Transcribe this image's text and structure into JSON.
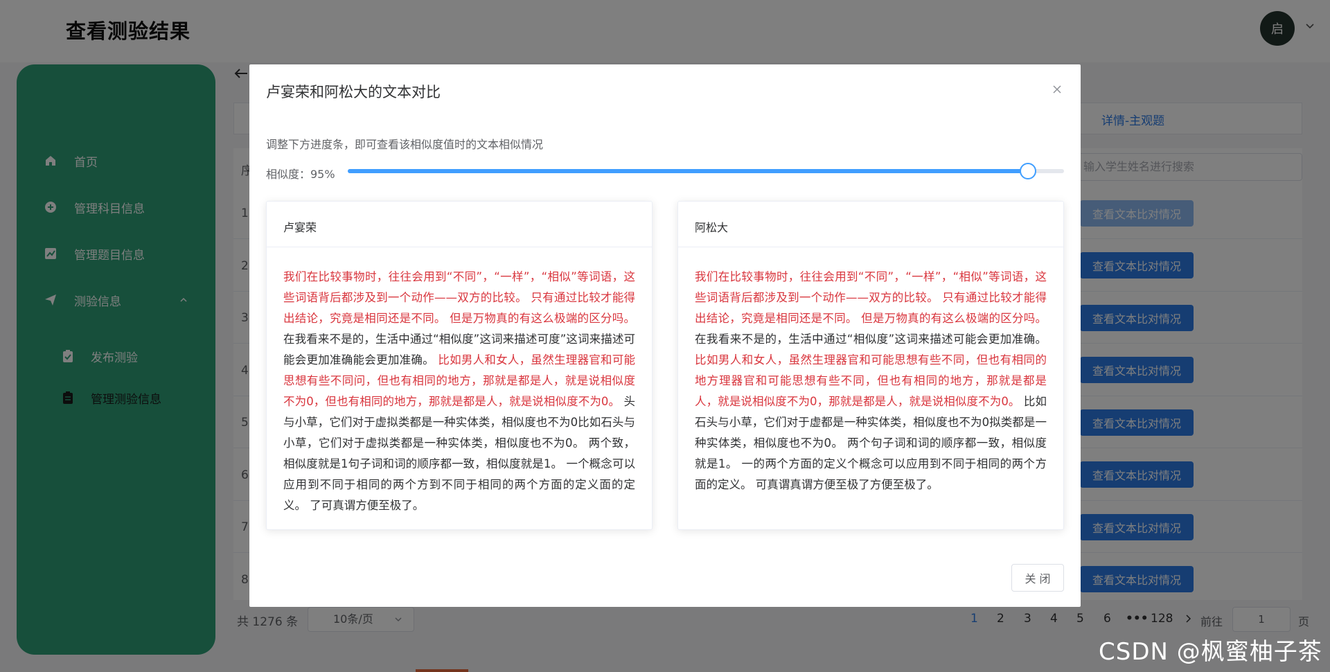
{
  "header": {
    "title": "查看测验结果",
    "avatar_text": "启"
  },
  "sidebar": {
    "items": [
      {
        "label": "首页",
        "icon": "home-icon"
      },
      {
        "label": "管理科目信息",
        "icon": "plus-circle-icon"
      },
      {
        "label": "管理题目信息",
        "icon": "chart-icon"
      },
      {
        "label": "测验信息",
        "icon": "send-icon"
      },
      {
        "label": "发布测验",
        "icon": "clipboard-check-icon"
      },
      {
        "label": "管理测验信息",
        "icon": "clipboard-icon"
      }
    ]
  },
  "main": {
    "tab_detail": "详情-主观题",
    "search_placeholder": "输入学生姓名进行搜索",
    "row_numbers": [
      "序",
      "1",
      "2",
      "3",
      "4",
      "5",
      "6",
      "7",
      "8"
    ],
    "view_button_label": "查看文本比对情况",
    "pagination": {
      "total": "共 1276 条",
      "page_size": "10条/页",
      "pages": [
        "1",
        "2",
        "3",
        "4",
        "5",
        "6",
        "•••",
        "128"
      ],
      "goto_label": "前往",
      "goto_value": "1",
      "page_unit": "页"
    }
  },
  "dialog": {
    "title": "卢宴荣和阿松大的文本对比",
    "hint": "调整下方进度条，即可查看该相似度值时的文本相似情况",
    "similarity_label": "相似度：95%",
    "similarity_value": 0.95,
    "close_button": "关 闭",
    "left_card": {
      "name": "卢宴荣",
      "segments": [
        {
          "text": "我们在比较事物时，往往会用到“不同”，“一样”，“相似”等词语，这些词语背后都涉及到一个动作——双方的比较。 只有通过比较才能得出结论，究竟是相同还是不同。 但是万物真的有这么极端的区分吗。",
          "red": true
        },
        {
          "text": " 在我看来不是的，生活中通过“相似度”这词来描述可度”这词来描述可能会更加准确能会更加准确。",
          "red": false
        },
        {
          "text": " 比如男人和女人，虽然生理器官和可能思想有些不同问，但也有相同的地方，那就是都是人，就是说相似度不为0，但也有相同的地方，那就是都是人，就是说相似度不为0。",
          "red": true
        },
        {
          "text": " 头与小草，它们对于虚拟类都是一种实体类，相似度也不为0比如石头与小草，它们对于虚拟类都是一种实体类，相似度也不为0。 两个致，相似度就是1句子词和词的顺序都一致，相似度就是1。 一个概念可以应用到不同于相同的两个方到不同于相同的两个方面的定义面的定义。 了可真谓方便至极了。",
          "red": false
        }
      ]
    },
    "right_card": {
      "name": "阿松大",
      "segments": [
        {
          "text": "我们在比较事物时，往往会用到“不同”，“一样”，“相似”等词语，这些词语背后都涉及到一个动作——双方的比较。 只有通过比较才能得出结论，究竟是相同还是不同。 但是万物真的有这么极端的区分吗。",
          "red": true
        },
        {
          "text": " 在我看来不是的，生活中通过“相似度”这词来描述可能会更加准确。",
          "red": false
        },
        {
          "text": " 比如男人和女人，虽然生理器官和可能思想有些不同，但也有相同的地方理器官和可能思想有些不同，但也有相同的地方，那就是都是人，就是说相似度不为0，那就是都是人，就是说相似度不为0。",
          "red": true
        },
        {
          "text": " 比如石头与小草，它们对于虚都是一种实体类，相似度也不为0拟类都是一种实体类，相似度也不为0。 两个句子词和词的顺序都一致，相似度就是1。 一的两个方面的定义个概念可以应用到不同于相同的两个方面的定义。 可真谓真谓方便至极了方便至极了。",
          "red": false
        }
      ]
    }
  },
  "watermark": "CSDN @枫蜜柚子茶",
  "colors": {
    "sidebar": "#2e9f77",
    "primary": "#2d7be5",
    "slider": "#409eff",
    "highlight": "#d9363e"
  }
}
